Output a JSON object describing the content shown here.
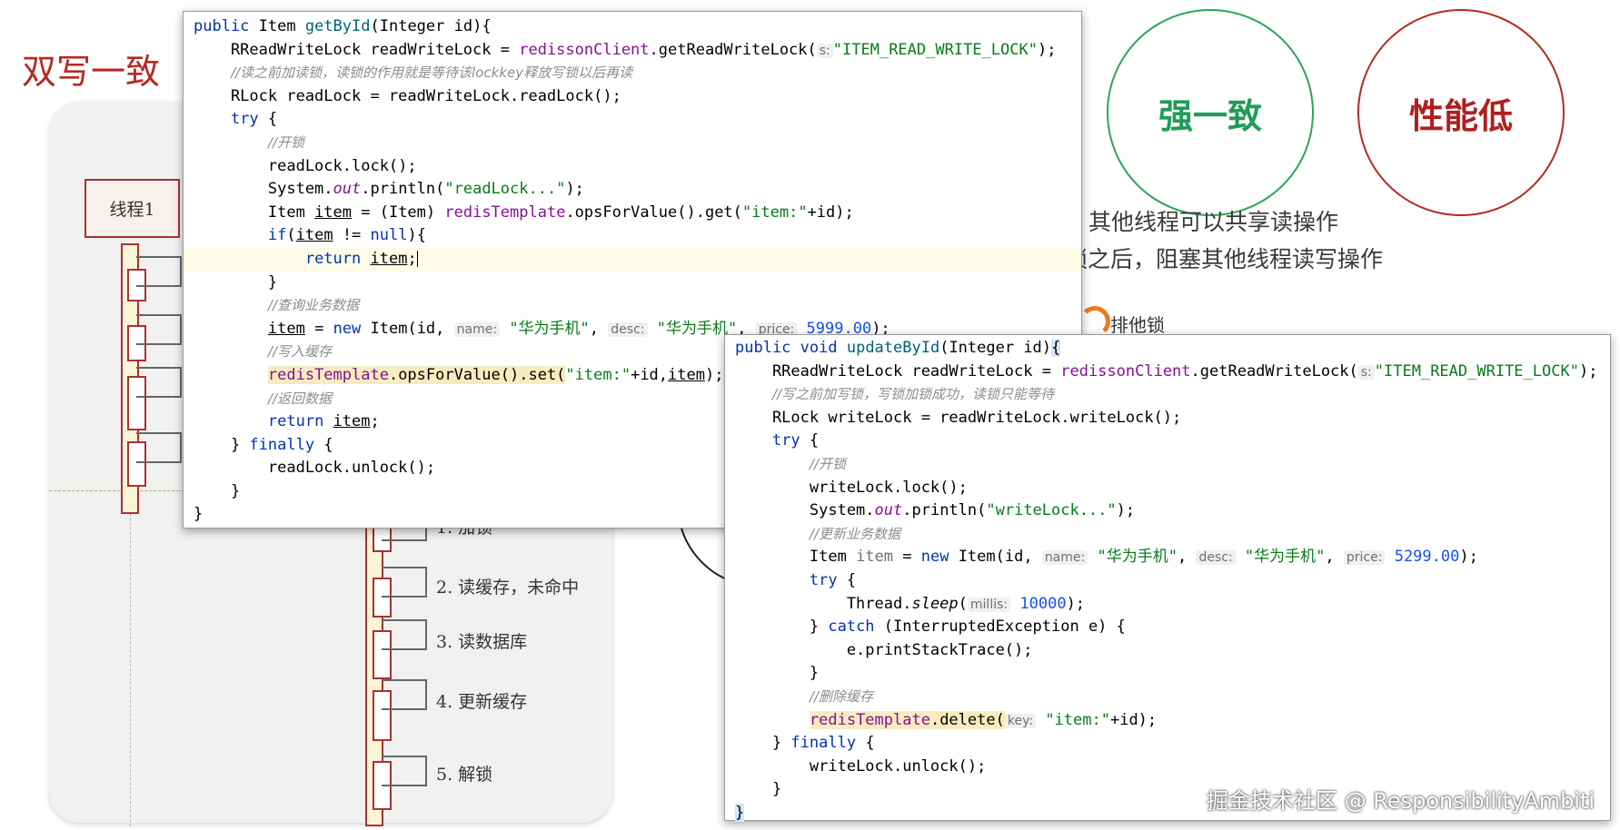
{
  "slide": {
    "title": "双写一致",
    "thread_label": "线程1",
    "steps": [
      "1. 加锁",
      "2. 读缓存，未命中",
      "3. 读数据库",
      "4. 更新缓存",
      "5.  解锁"
    ],
    "badges": {
      "strong": "强一致",
      "low_perf": "性能低"
    },
    "notes": [
      "其他线程可以共享读操作",
      "锁之后，阻塞其他线程读写操作"
    ],
    "lock_label": "排他锁",
    "watermark": "掘金技术社区 @ ResponsibilityAmbiti"
  },
  "colors": {
    "title_red": "#b52a22",
    "strong_green": "#1f9d55",
    "low_perf_red": "#b01f1f",
    "keyword_blue": "#0033b3",
    "string_green": "#067d17"
  },
  "read_method": {
    "line1": {
      "kw": "public",
      "type": " Item ",
      "name": "getById",
      "rest": "(Integer id){"
    },
    "line2": {
      "pre": "    RReadWriteLock readWriteLock = ",
      "field": "redissonClient",
      "mid": ".getReadWriteLock(",
      "hint": "s:",
      "str": "\"ITEM_READ_WRITE_LOCK\"",
      "end": ");"
    },
    "line3": {
      "comment": "//读之前加读锁，读锁的作用就是等待该lockkey释放写锁以后再读"
    },
    "line4": {
      "text": "    RLock readLock = readWriteLock.readLock();"
    },
    "line5": {
      "kw": "try",
      "end": " {"
    },
    "line6": {
      "comment": "//开锁"
    },
    "line7": {
      "text": "        readLock.lock();"
    },
    "line8": {
      "pre": "        System.",
      "st": "out",
      "mid": ".println(",
      "str": "\"readLock...\"",
      "end": ");"
    },
    "line9": {
      "pre": "        Item ",
      "var": "item",
      "mid": " = (Item) ",
      "field": "redisTemplate",
      "mid2": ".opsForValue().get(",
      "str": "\"item:\"",
      "end": "+id);"
    },
    "line10": {
      "kw": "if",
      "pre": "(",
      "var": "item",
      "mid": " != ",
      "kw2": "null",
      "end": "){"
    },
    "line11": {
      "kw": "return",
      "var": "item",
      "end": ";"
    },
    "line12": {
      "text": "        }"
    },
    "line13": {
      "comment": "//查询业务数据"
    },
    "line14": {
      "var": "item",
      "mid": " = ",
      "kw": "new",
      "mid2": " Item(id, ",
      "hint1": "name:",
      "str1": "\"华为手机\"",
      "hint2": "desc:",
      "str2": "\"华为手机\"",
      "hint3": "price:",
      "num": "5999.00",
      "end": ");"
    },
    "line15": {
      "comment": "//写入缓存"
    },
    "line16": {
      "field": "redisTemplate",
      "mid": ".opsForValue().set(",
      "str": "\"item:\"",
      "mid2": "+id,",
      "var": "item",
      "end": ");"
    },
    "line17": {
      "comment": "//返回数据"
    },
    "line18": {
      "kw": "return",
      "var": "item",
      "end": ";"
    },
    "line19": {
      "pre": "    } ",
      "kw": "finally",
      "end": " {"
    },
    "line20": {
      "text": "        readLock.unlock();"
    },
    "line21": {
      "text": "    }"
    },
    "line22": {
      "text": "}"
    }
  },
  "write_method": {
    "line1": {
      "kw": "public void",
      "name": "updateById",
      "rest": "(Integer id)",
      "brace": "{"
    },
    "line2": {
      "pre": "    RReadWriteLock readWriteLock = ",
      "field": "redissonClient",
      "mid": ".getReadWriteLock(",
      "hint": "s:",
      "str": "\"ITEM_READ_WRITE_LOCK\"",
      "end": ");"
    },
    "line3": {
      "comment": "//写之前加写锁，写锁加锁成功，读锁只能等待"
    },
    "line4": {
      "text": "    RLock writeLock = readWriteLock.writeLock();"
    },
    "line5": {
      "kw": "try",
      "end": " {"
    },
    "line6": {
      "comment": "//开锁"
    },
    "line7": {
      "text": "        writeLock.lock();"
    },
    "line8": {
      "pre": "        System.",
      "st": "out",
      "mid": ".println(",
      "str": "\"writeLock...\"",
      "end": ");"
    },
    "line9": {
      "comment": "//更新业务数据"
    },
    "line10": {
      "pre": "        Item ",
      "var": "item",
      "mid": " = ",
      "kw": "new",
      "mid2": " Item(id, ",
      "hint1": "name:",
      "str1": "\"华为手机\"",
      "hint2": "desc:",
      "str2": "\"华为手机\"",
      "hint3": "price:",
      "num": "5299.00",
      "end": ");"
    },
    "line11": {
      "kw": "try",
      "end": " {"
    },
    "line12": {
      "pre": "            Thread.",
      "st": "sleep",
      "mid": "(",
      "hint": "millis:",
      "num": "10000",
      "end": ");"
    },
    "line13": {
      "pre": "        } ",
      "kw": "catch",
      "end": " (InterruptedException e) {"
    },
    "line14": {
      "text": "            e.printStackTrace();"
    },
    "line15": {
      "text": "        }"
    },
    "line16": {
      "comment": "//删除缓存"
    },
    "line17": {
      "field": "redisTemplate",
      "mid": ".delete(",
      "hint": "key:",
      "str": "\"item:\"",
      "end": "+id);"
    },
    "line18": {
      "pre": "    } ",
      "kw": "finally",
      "end": " {"
    },
    "line19": {
      "text": "        writeLock.unlock();"
    },
    "line20": {
      "text": "    }"
    },
    "line21": {
      "text": "}"
    }
  }
}
